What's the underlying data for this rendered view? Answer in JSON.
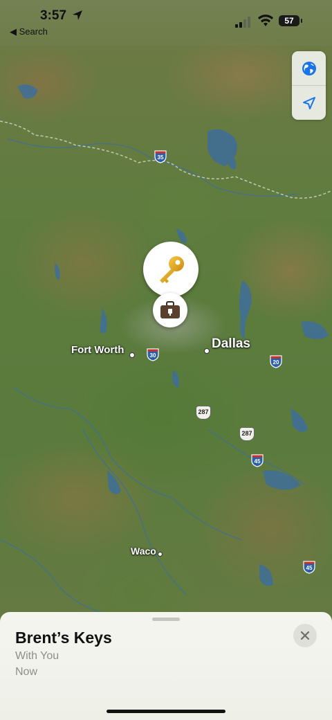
{
  "status_bar": {
    "time": "3:57",
    "back_label": "◀ Search",
    "battery": "57"
  },
  "map": {
    "cities": [
      {
        "name": "Fort Worth",
        "label": "Fort Worth"
      },
      {
        "name": "Dallas",
        "label": "Dallas"
      },
      {
        "name": "Waco",
        "label": "Waco"
      }
    ],
    "interstate_shields": [
      "35",
      "30",
      "20",
      "45",
      "45"
    ],
    "us_highway_shields": [
      "287",
      "287"
    ]
  },
  "controls": {
    "map_mode_icon": "globe-icon",
    "locate_icon": "location-arrow-icon"
  },
  "pins": {
    "keys_icon": "key-icon",
    "bag_icon": "briefcase-icon"
  },
  "sheet": {
    "title": "Brent’s Keys",
    "subtitle": "With You",
    "time": "Now"
  },
  "colors": {
    "interstate_blue": "#2d5fa8",
    "interstate_red": "#c9302c",
    "water": "#3e6e9a",
    "key_gold": "#e6a817"
  }
}
